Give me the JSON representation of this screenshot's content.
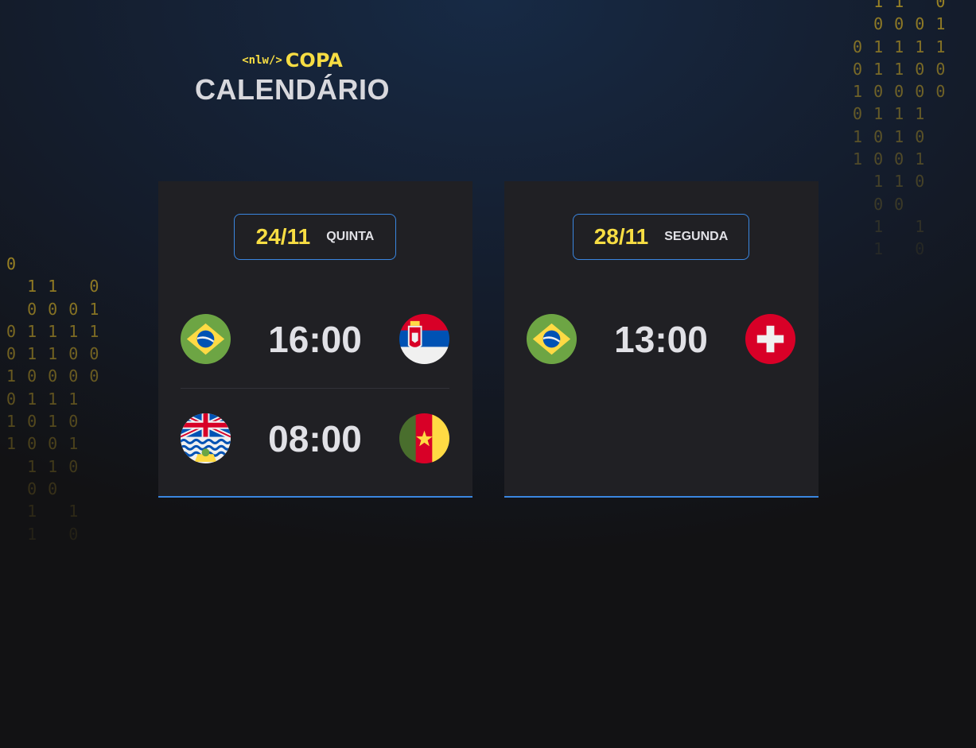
{
  "header": {
    "logo_tag": "<nlw/>",
    "logo_name": "COPA",
    "title": "CALENDÁRIO"
  },
  "background": {
    "binary_left": [
      "0",
      " 11 0",
      " 0001",
      "01111",
      "01100",
      "10000",
      "0111",
      "1010",
      "1001",
      " 110",
      " 00",
      " 1 1",
      " 1 0"
    ],
    "binary_right": [
      " 11 0",
      " 0001",
      "01111",
      "01100",
      "10000",
      "0111",
      "1010",
      "1001",
      " 110",
      " 00",
      " 1 1",
      " 1 0"
    ]
  },
  "cards": [
    {
      "date": "24/11",
      "weekday": "QUINTA",
      "matches": [
        {
          "home": "brazil-flag",
          "time": "16:00",
          "away": "serbia-flag"
        },
        {
          "home": "british-indian-ocean-territory-flag",
          "time": "08:00",
          "away": "cameroon-flag"
        }
      ]
    },
    {
      "date": "28/11",
      "weekday": "SEGUNDA",
      "matches": [
        {
          "home": "brazil-flag",
          "time": "13:00",
          "away": "switzerland-flag"
        }
      ]
    }
  ],
  "colors": {
    "accent_yellow": "#f7dd43",
    "accent_blue": "#3a86e0",
    "card_bg": "#202024"
  }
}
